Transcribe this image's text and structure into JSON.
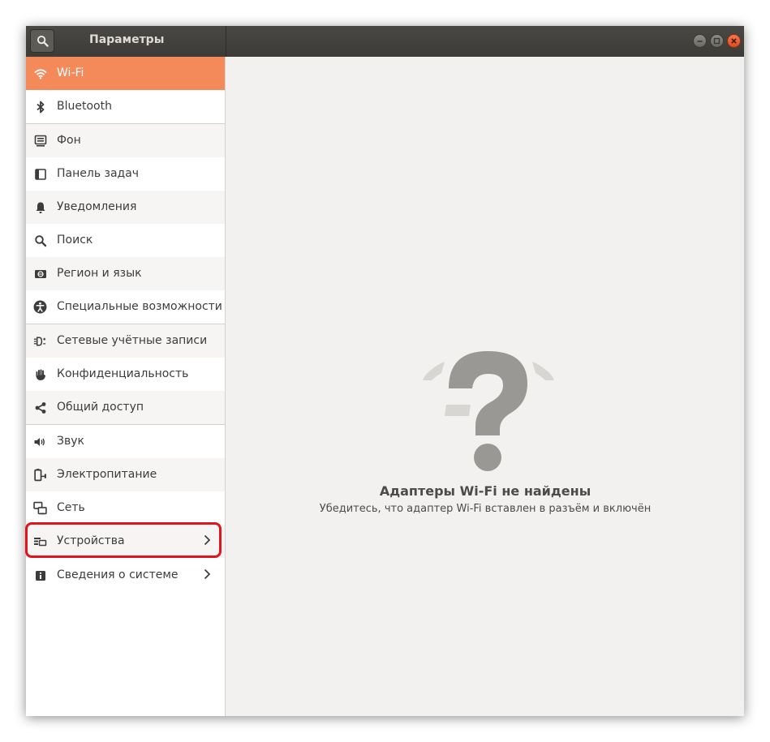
{
  "window": {
    "title": "Параметры"
  },
  "sidebar": {
    "items": [
      {
        "label": "Wi-Fi",
        "icon": "wifi-icon"
      },
      {
        "label": "Bluetooth",
        "icon": "bluetooth-icon"
      },
      {
        "label": "Фон",
        "icon": "background-icon"
      },
      {
        "label": "Панель задач",
        "icon": "dock-icon"
      },
      {
        "label": "Уведомления",
        "icon": "bell-icon"
      },
      {
        "label": "Поиск",
        "icon": "search-icon"
      },
      {
        "label": "Регион и язык",
        "icon": "region-icon"
      },
      {
        "label": "Специальные возможности",
        "icon": "accessibility-icon"
      },
      {
        "label": "Сетевые учётные записи",
        "icon": "online-accounts-icon"
      },
      {
        "label": "Конфиденциальность",
        "icon": "hand-icon"
      },
      {
        "label": "Общий доступ",
        "icon": "share-icon"
      },
      {
        "label": "Звук",
        "icon": "speaker-icon"
      },
      {
        "label": "Электропитание",
        "icon": "power-icon"
      },
      {
        "label": "Сеть",
        "icon": "network-icon"
      },
      {
        "label": "Устройства",
        "icon": "devices-icon"
      },
      {
        "label": "Сведения о системе",
        "icon": "info-icon"
      }
    ],
    "active_index": 0,
    "highlighted_item": "Устройства"
  },
  "main": {
    "empty_title": "Адаптеры Wi-Fi не найдены",
    "empty_subtitle": "Убедитесь, что адаптер Wi-Fi вставлен в разъём и включён",
    "empty_icon": "question-mark-icon"
  },
  "colors": {
    "accent": "#f48a5a",
    "titlebar": "#3c3b37",
    "highlight": "#e0141c",
    "icon_gray": "#9a9894"
  }
}
